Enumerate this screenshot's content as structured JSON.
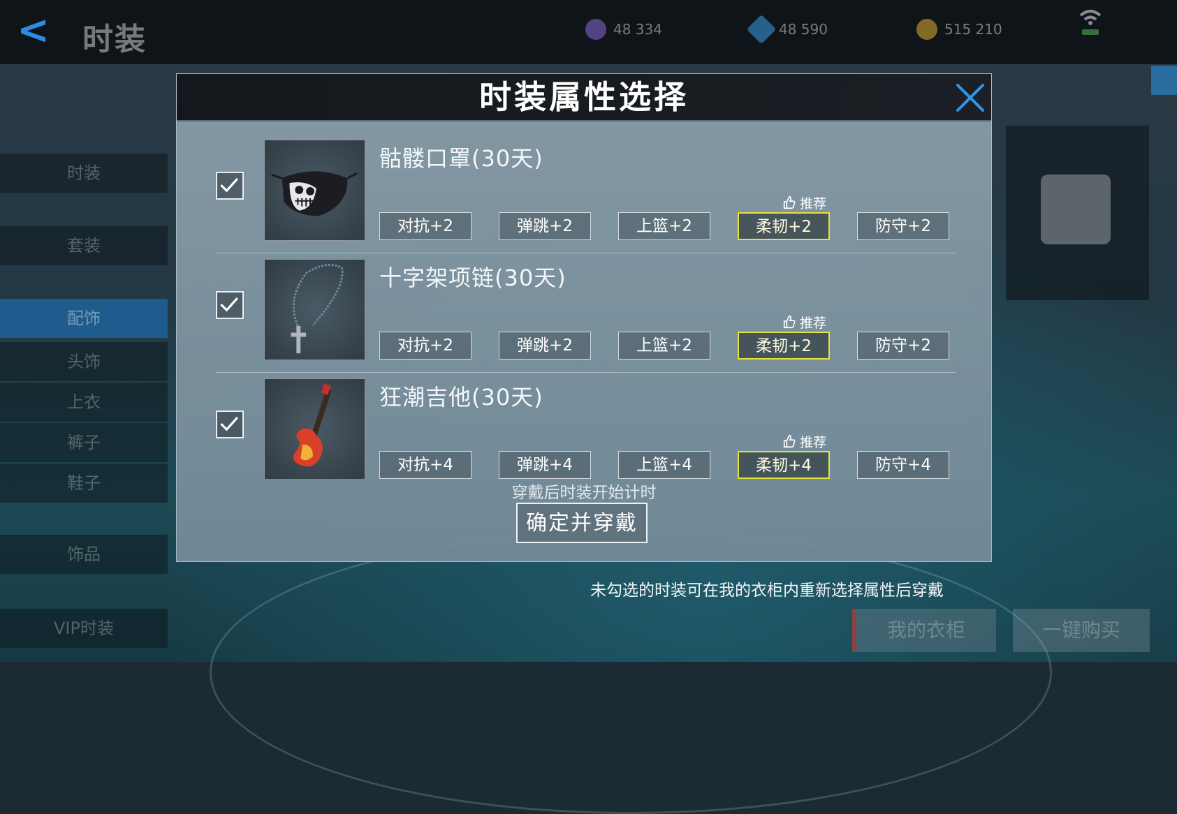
{
  "background": {
    "page_title": "时装",
    "currencies": [
      {
        "icon": "purple-gem-icon",
        "value": "48 334",
        "color": "#8a6ad8"
      },
      {
        "icon": "blue-diamond-icon",
        "value": "48 590",
        "color": "#3aa0e8"
      },
      {
        "icon": "gold-coin-icon",
        "value": "515 210",
        "color": "#e0b030"
      }
    ],
    "sidebar_items": [
      "时装",
      "套装",
      "配饰",
      "头饰",
      "上衣",
      "裤子",
      "鞋子",
      "饰品",
      "VIP时装"
    ],
    "buttons": {
      "wardrobe": "我的衣柜",
      "buy_all": "一键购买"
    }
  },
  "modal": {
    "title": "时装属性选择",
    "items": [
      {
        "name": "骷髅口罩(30天)",
        "checked": true,
        "thumbnail": "skull-mask-icon",
        "recommend_label": "推荐",
        "attributes": [
          "对抗+2",
          "弹跳+2",
          "上篮+2",
          "柔韧+2",
          "防守+2"
        ],
        "selected_index": 3
      },
      {
        "name": "十字架项链(30天)",
        "checked": true,
        "thumbnail": "cross-necklace-icon",
        "recommend_label": "推荐",
        "attributes": [
          "对抗+2",
          "弹跳+2",
          "上篮+2",
          "柔韧+2",
          "防守+2"
        ],
        "selected_index": 3
      },
      {
        "name": "狂潮吉他(30天)",
        "checked": true,
        "thumbnail": "electric-guitar-icon",
        "recommend_label": "推荐",
        "attributes": [
          "对抗+4",
          "弹跳+4",
          "上篮+4",
          "柔韧+4",
          "防守+4"
        ],
        "selected_index": 3
      }
    ],
    "timer_notice": "穿戴后时装开始计时",
    "confirm_label": "确定并穿戴"
  },
  "footer_note": "未勾选的时装可在我的衣柜内重新选择属性后穿戴",
  "colors": {
    "accent_blue": "#2f8ae0",
    "selected_border": "#e7e23a",
    "modal_header": "#14181c"
  }
}
